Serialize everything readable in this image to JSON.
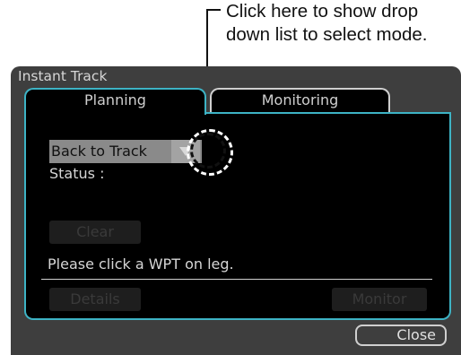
{
  "callout": {
    "line1": "Click here to show drop",
    "line2": "down list to select mode."
  },
  "window": {
    "title": "Instant Track"
  },
  "tabs": [
    {
      "label": "Planning",
      "active": true
    },
    {
      "label": "Monitoring",
      "active": false
    }
  ],
  "planning": {
    "mode_value": "Back to Track",
    "status_label": "Status :",
    "clear_label": "Clear",
    "hint": "Please click a WPT on leg.",
    "details_label": "Details",
    "monitor_label": "Monitor"
  },
  "footer": {
    "close_label": "Close"
  },
  "colors": {
    "accent": "#3db3c5",
    "window_bg": "#3e3e3e",
    "panel_bg": "#000000"
  },
  "icons": {
    "dropdown": "triangle-down-icon"
  }
}
